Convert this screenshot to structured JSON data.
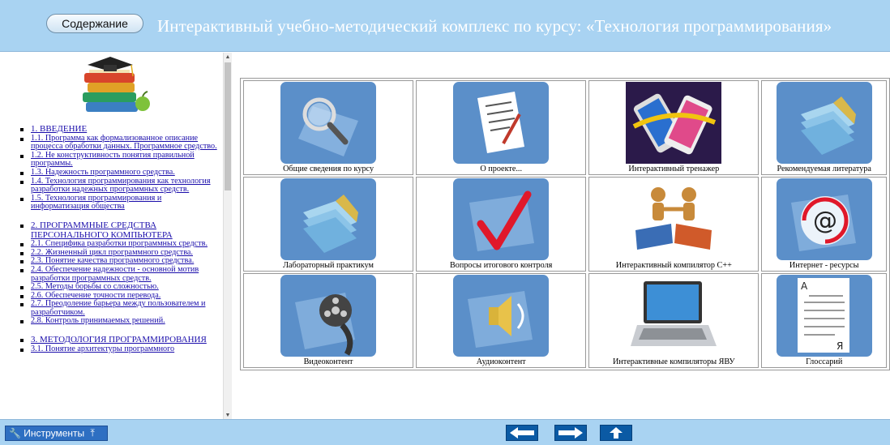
{
  "header": {
    "toc_button": "Содержание",
    "title": "Интерактивный учебно-методический комплекс по курсу: «Технология программирования»"
  },
  "sidebar": {
    "items": [
      {
        "label": "1. ВВЕДЕНИЕ",
        "section": true
      },
      {
        "label": "1.1. Программа как формализованное описание процесса обработки данных. Программное средство."
      },
      {
        "label": "1.2. Не конструктивность понятия правильной программы."
      },
      {
        "label": "1.3. Надежность программного средства."
      },
      {
        "label": "1.4. Технология программирования как технология разработки надежных программных средств."
      },
      {
        "label": "1.5. Технология программирования и информатизация общества"
      },
      {
        "label": "2. ПРОГРАММНЫЕ СРЕДСТВА ПЕРСОНАЛЬНОГО КОМПЬЮТЕРА",
        "section": true,
        "gap": true
      },
      {
        "label": "2.1. Специфика разработки программных средств."
      },
      {
        "label": "2.2. Жизненный цикл программного средства."
      },
      {
        "label": "2.3. Понятие качества программного средства."
      },
      {
        "label": "2.4. Обеспечение надежности - основной мотив разработки программных средств."
      },
      {
        "label": "2.5. Методы борьбы со сложностью."
      },
      {
        "label": "2.6. Обеспечение точности перевода."
      },
      {
        "label": "2.7. Преодоление барьера между пользователем и разработчиком."
      },
      {
        "label": "2.8. Контроль принимаемых решений."
      },
      {
        "label": "3. МЕТОДОЛОГИЯ ПРОГРАММИРОВАНИЯ",
        "section": true,
        "gap": true
      },
      {
        "label": "3.1. Понятие архитектуры программного"
      }
    ]
  },
  "grid": {
    "cells": [
      {
        "caption": "Общие сведения по курсу",
        "icon": "magnifier-icon"
      },
      {
        "caption": "О проекте...",
        "icon": "document-pen-icon"
      },
      {
        "caption": "Интерактивный тренажер",
        "icon": "smartphones-icon"
      },
      {
        "caption": "Рекомендуемая литература",
        "icon": "books-stack-icon"
      },
      {
        "caption": "Лабораторный практикум",
        "icon": "papers-stack-icon"
      },
      {
        "caption": "Вопросы итогового контроля",
        "icon": "checkmark-icon"
      },
      {
        "caption": "Интерактивный компилятор С++",
        "icon": "puzzle-figures-icon"
      },
      {
        "caption": "Интернет - ресурсы",
        "icon": "at-sign-icon"
      },
      {
        "caption": "Видеоконтент",
        "icon": "film-reel-icon"
      },
      {
        "caption": "Аудиоконтент",
        "icon": "speaker-icon"
      },
      {
        "caption": "Интерактивные компиляторы ЯВУ",
        "icon": "laptop-icon"
      },
      {
        "caption": "Глоссарий",
        "icon": "glossary-page-icon"
      }
    ]
  },
  "footer": {
    "tools_label": "Инструменты",
    "pin_glyph": "⤒"
  },
  "colors": {
    "header_bg": "#a9d3f2",
    "tile_bg": "#5b8fc9",
    "nav_btn": "#0b5aa4",
    "link": "#1a0dab"
  }
}
